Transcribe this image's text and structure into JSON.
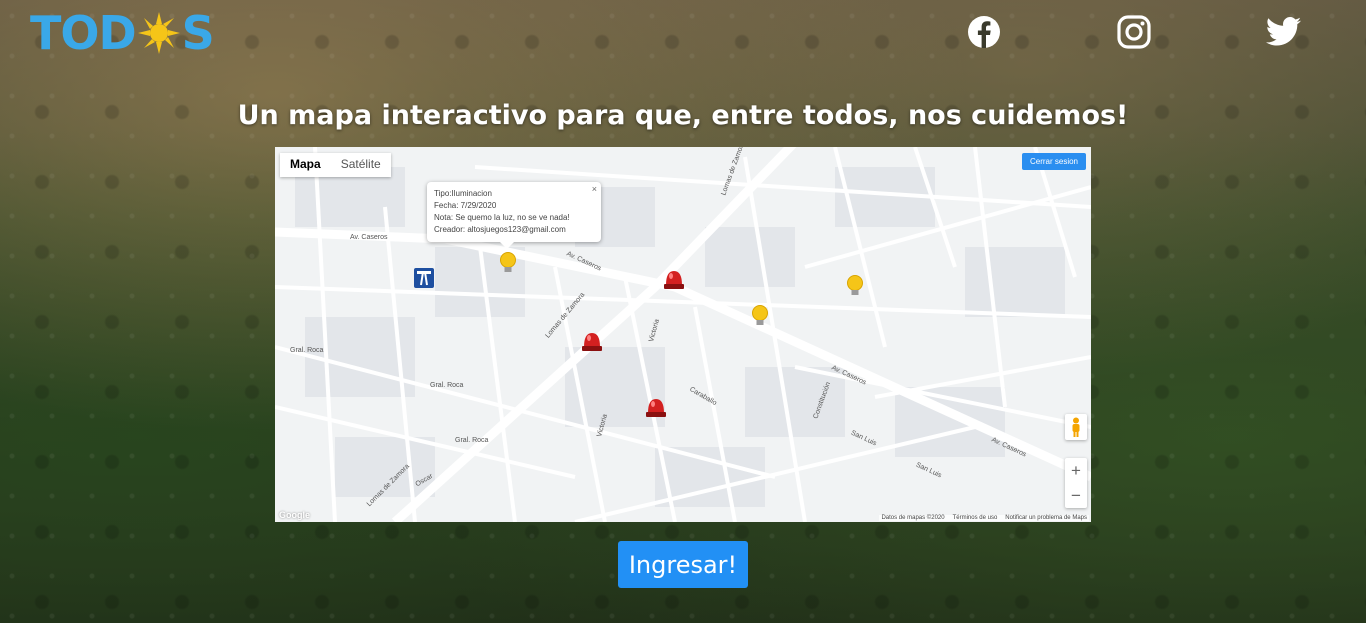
{
  "header": {
    "logo_text_pre": "TOD",
    "logo_text_post": "S",
    "social": [
      "facebook-icon",
      "instagram-icon",
      "twitter-icon"
    ]
  },
  "title": "Un mapa interactivo para que, entre todos, nos cuidemos!",
  "map": {
    "type_tabs": [
      "Mapa",
      "Satélite"
    ],
    "logout_label": "Cerrar sesion",
    "infowindow": {
      "tipo": "Tipo:Iluminacion",
      "fecha": "Fecha: 7/29/2020",
      "nota": "Nota: Se quemo la luz, no se ve nada!",
      "creador": "Creador: altosjuegos123@gmail.com",
      "close": "×"
    },
    "zoom_in": "+",
    "zoom_out": "−",
    "google_logo": "Google",
    "footer": [
      "Datos de mapas ©2020",
      "Términos de uso",
      "Notificar un problema de Maps"
    ],
    "streets": {
      "caseros_1": "Av. Caseros",
      "caseros_2": "Av. Caseros",
      "caseros_3": "Av. Caseros",
      "caseros_4": "Av. Caseros",
      "zamora_1": "Lomas de Zamora",
      "zamora_2": "Lomas de Zamora",
      "zamora_3": "Lomas de Zamora",
      "roca_1": "Gral. Roca",
      "roca_2": "Gral. Roca",
      "roca_3": "Gral. Roca",
      "oscar": "Oscar",
      "victoria_1": "Victoria",
      "victoria_2": "Victoria",
      "caraballo": "Caraballo",
      "san_luis_1": "San Luis",
      "san_luis_2": "San Luis",
      "constitucion": "Constitución"
    },
    "colors": {
      "alert": "#d32020",
      "bulb": "#f5c518",
      "button": "#2290f5"
    }
  },
  "cta": {
    "label": "Ingresar!"
  }
}
